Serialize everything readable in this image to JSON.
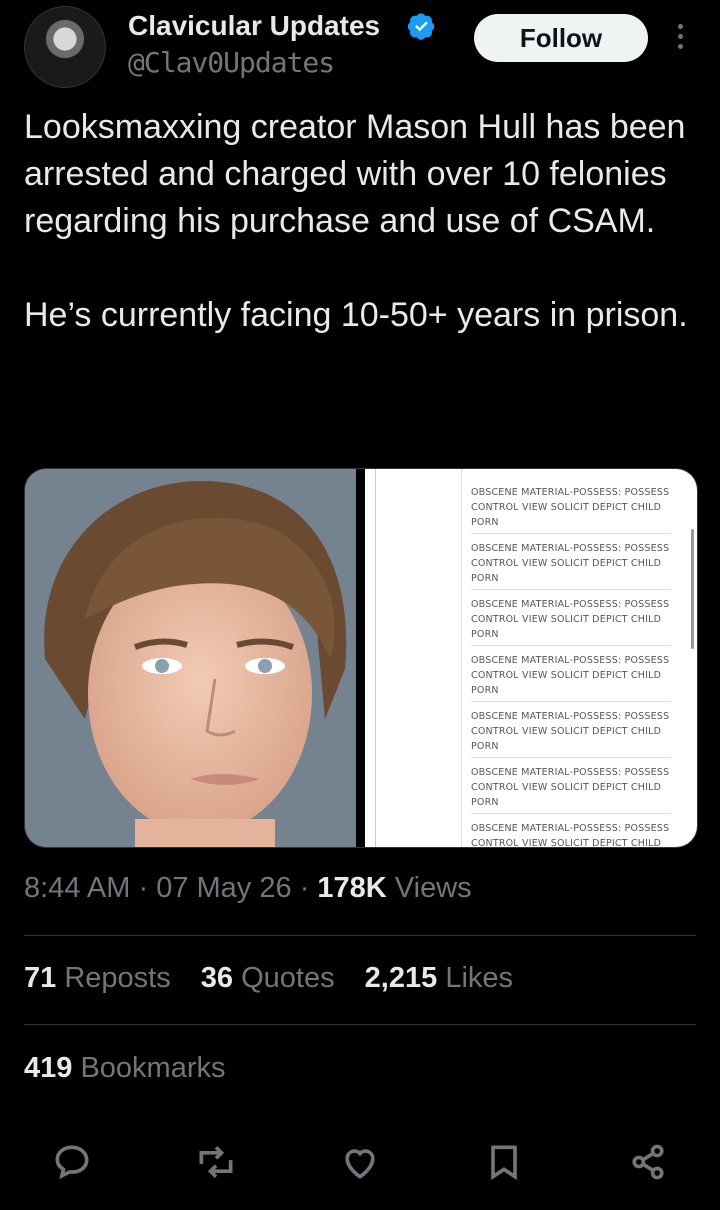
{
  "author": {
    "name": "Clavicular Updates",
    "handle": "@Clav0Updates",
    "verified": true,
    "avatar_icon": "avatar-photo"
  },
  "follow_label": "Follow",
  "tweet": {
    "text": "Looksmaxxing creator Mason Hull has been arrested and charged with over 10 felonies regarding his purchase and use of CSAM.\n\nHe’s currently facing 10-50+ years in prison."
  },
  "media": {
    "left_image": "mugshot-photo",
    "charges": [
      "OBSCENE MATERIAL-POSSESS: POSSESS CONTROL VIEW SOLICIT DEPICT CHILD PORN",
      "OBSCENE MATERIAL-POSSESS: POSSESS CONTROL VIEW SOLICIT DEPICT CHILD PORN",
      "OBSCENE MATERIAL-POSSESS: POSSESS CONTROL VIEW SOLICIT DEPICT CHILD PORN",
      "OBSCENE MATERIAL-POSSESS: POSSESS CONTROL VIEW SOLICIT DEPICT CHILD PORN",
      "OBSCENE MATERIAL-POSSESS: POSSESS CONTROL VIEW SOLICIT DEPICT CHILD PORN",
      "OBSCENE MATERIAL-POSSESS: POSSESS CONTROL VIEW SOLICIT DEPICT CHILD PORN",
      "OBSCENE MATERIAL-POSSESS: POSSESS CONTROL VIEW SOLICIT DEPICT CHILD PORN"
    ]
  },
  "meta": {
    "time": "8:44 AM",
    "date": "07 May 26",
    "views_count": "178K",
    "views_label": "Views",
    "separator": "·"
  },
  "stats": {
    "reposts_count": "71",
    "reposts_label": "Reposts",
    "quotes_count": "36",
    "quotes_label": "Quotes",
    "likes_count": "2,215",
    "likes_label": "Likes",
    "bookmarks_count": "419",
    "bookmarks_label": "Bookmarks"
  },
  "colors": {
    "background": "#000000",
    "text": "#e7e9ea",
    "muted": "#71767b",
    "verified": "#1d9bf0",
    "divider": "#2f3336"
  },
  "actions": [
    "reply-icon",
    "repost-icon",
    "like-icon",
    "bookmark-icon",
    "share-icon"
  ]
}
